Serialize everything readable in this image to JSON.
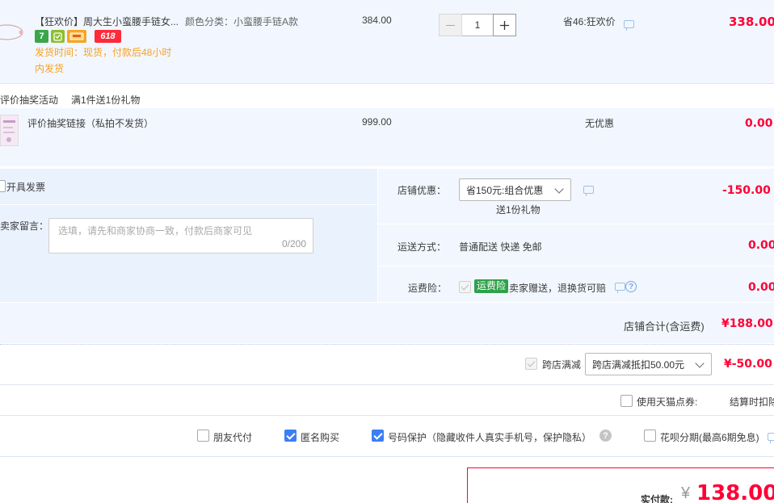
{
  "item1": {
    "title": "【狂欢价】周大生小蛮腰手链女...",
    "sku_label": "颜色分类：",
    "sku_value": "小蛮腰手链A款",
    "unit_price": "384.00",
    "quantity": "1",
    "discount": "省46:狂欢价",
    "subtotal": "338.00",
    "tag_7": "7",
    "tag_618": "618",
    "ship_line1": "发货时间：现货，付款后48小时",
    "ship_line2": "内发货"
  },
  "promo": {
    "label": "评价抽奖活动",
    "gift": "满1件送1份礼物"
  },
  "item2": {
    "title": "评价抽奖链接（私拍不发货）",
    "unit_price": "999.00",
    "discount": "无优惠",
    "subtotal": "0.00"
  },
  "order": {
    "invoice_label": "开具发票",
    "message_label": "卖家留言：",
    "message_placeholder": "选填，请先和商家协商一致，付款后商家可见",
    "message_count": "0/200",
    "shop_discount_label": "店铺优惠：",
    "shop_discount_value": "省150元:组合优惠",
    "shop_gift": "送1份礼物",
    "shop_discount_amount": "-150.00",
    "shipping_label": "运送方式：",
    "shipping_value": "普通配送 快递 免邮",
    "shipping_amount": "0.00",
    "insurance_label": "运费险：",
    "insurance_badge": "运费险",
    "insurance_text": "卖家赠送，退换货可赔",
    "insurance_amount": "0.00",
    "shop_total_label": "店铺合计(含运费)",
    "shop_total_value": "¥188.00"
  },
  "cross": {
    "label": "跨店满减",
    "select_value": "跨店满减抵扣50.00元",
    "amount": "¥-50.00"
  },
  "coupon": {
    "label": "使用天猫点券:",
    "note": "结算时扣除"
  },
  "options": {
    "friend_pay": "朋友代付",
    "anonymous": "匿名购买",
    "privacy": "号码保护（隐藏收件人真实手机号，保护隐私）",
    "huabei": "花呗分期(最高6期免息)"
  },
  "pay": {
    "label": "实付款:",
    "currency": "¥",
    "amount": "138.00"
  }
}
